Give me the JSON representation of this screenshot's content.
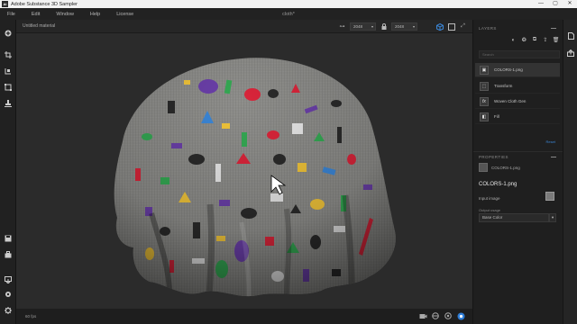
{
  "titlebar": {
    "app_icon": "Ai",
    "app_title": "Adobe Substance 3D Sampler",
    "minimize": "—",
    "maximize": "▢",
    "close": "✕"
  },
  "menubar": {
    "items": [
      "File",
      "Edit",
      "Window",
      "Help",
      "License"
    ],
    "document_title": "cloth*"
  },
  "viewport_header": {
    "title": "Untitled material",
    "resolution_a": "2048",
    "resolution_b": "2048"
  },
  "viewport_footer": {
    "fps": "60 fps"
  },
  "layers_panel": {
    "header": "LAYERS",
    "search_placeholder": "Search",
    "layers": [
      {
        "label": "COLORS-1.png",
        "icon": "image-icon"
      },
      {
        "label": "Transform",
        "icon": "transform-icon"
      },
      {
        "label": "Woven Cloth Gen",
        "icon": "fx-icon"
      },
      {
        "label": "Fill",
        "icon": "fill-icon"
      }
    ],
    "reset": "Reset"
  },
  "properties_panel": {
    "header": "PROPERTIES",
    "file": "COLORS-1.png",
    "name": "COLORS-1.png",
    "input_label": "Input image",
    "output_label": "Output usage",
    "output_value": "Base Color"
  },
  "colors": {
    "accent": "#2f7ed8",
    "cloth": "#8f8f8c",
    "bg": "#2b2b2b"
  }
}
